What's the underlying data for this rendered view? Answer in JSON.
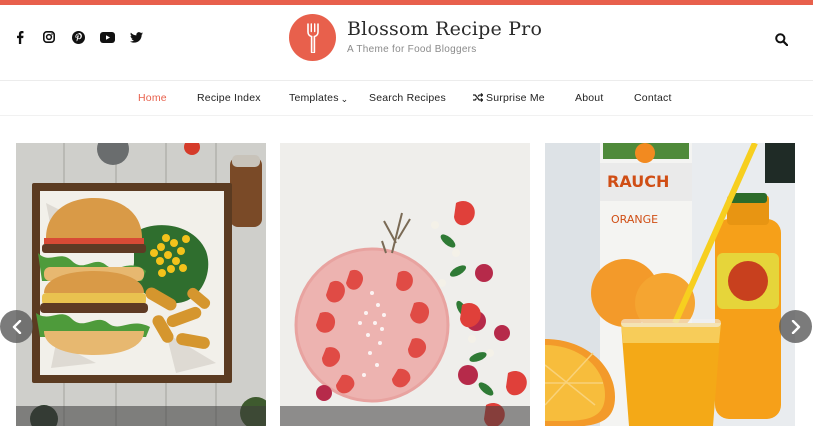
{
  "site": {
    "title": "Blossom Recipe Pro",
    "tagline": "A Theme for Food Bloggers",
    "accent_color": "#e8604c"
  },
  "social": [
    {
      "name": "facebook-icon"
    },
    {
      "name": "instagram-icon"
    },
    {
      "name": "pinterest-icon"
    },
    {
      "name": "youtube-icon"
    },
    {
      "name": "twitter-icon"
    }
  ],
  "header": {
    "search_icon": "search-icon",
    "logo_icon": "fork-icon"
  },
  "nav": {
    "items": [
      {
        "label": "Home",
        "active": true
      },
      {
        "label": "Recipe Index"
      },
      {
        "label": "Templates",
        "has_dropdown": true
      },
      {
        "label": "Search Recipes"
      },
      {
        "label": "Surprise Me",
        "icon": "shuffle-icon"
      },
      {
        "label": "About"
      },
      {
        "label": "Contact"
      }
    ]
  },
  "slider": {
    "slides": [
      {
        "name": "burger-and-corn-tray"
      },
      {
        "name": "strawberry-smoothie-bowl"
      },
      {
        "name": "orange-juice",
        "label_text": [
          "RAUCH",
          "ORANGE"
        ]
      }
    ],
    "prev_icon": "chevron-left-icon",
    "next_icon": "chevron-right-icon"
  }
}
